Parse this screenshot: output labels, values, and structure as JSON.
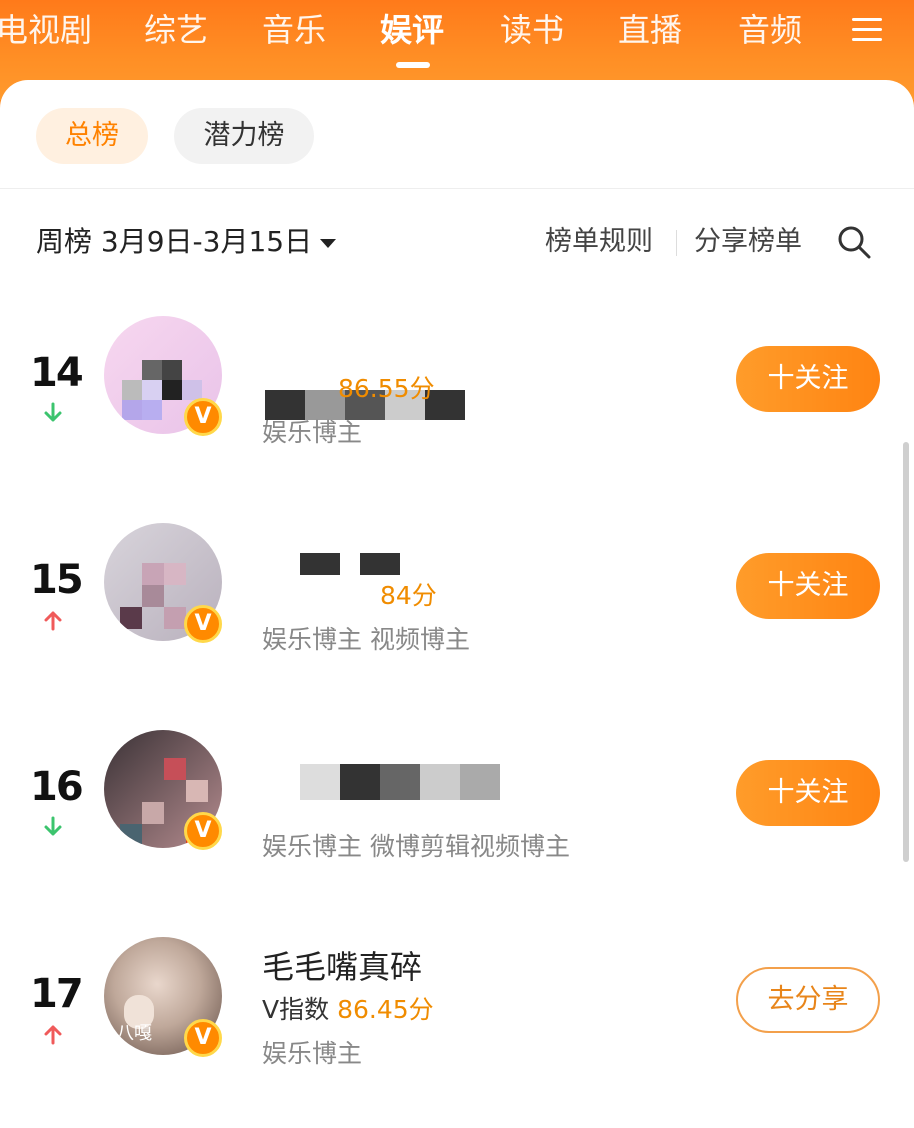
{
  "nav": {
    "tabs": [
      "电视剧",
      "综艺",
      "音乐",
      "娱评",
      "读书",
      "直播",
      "音频"
    ],
    "active_tab": "娱评",
    "menu_icon": "menu-icon"
  },
  "chips": {
    "primary": "总榜",
    "secondary": "潜力榜"
  },
  "filter": {
    "period": "周榜 3月9日-3月15日",
    "rules": "榜单规则",
    "share": "分享榜单"
  },
  "rows": [
    {
      "rank": "14",
      "trend": "down",
      "name": "",
      "vindex_label": "",
      "score": "86.55分",
      "tags": "娱乐博主",
      "button": "十关注"
    },
    {
      "rank": "15",
      "trend": "up",
      "name": "",
      "vindex_label": "",
      "score": "84分",
      "tags": "娱乐博主 视频博主",
      "button": "十关注"
    },
    {
      "rank": "16",
      "trend": "down",
      "name": "",
      "vindex_label": "",
      "score": "",
      "tags": "娱乐博主 微博剪辑视频博主",
      "button": "十关注"
    },
    {
      "rank": "17",
      "trend": "up",
      "name": "毛毛嘴真碎",
      "vindex_label": "V指数",
      "score": "86.45分",
      "tags": "娱乐博主",
      "button": "去分享",
      "avatar_caption": "八嘎"
    }
  ],
  "colors": {
    "brand_orange": "#ff8a1e",
    "score_orange": "#f08c00",
    "trend_up": "#f05a5a",
    "trend_down": "#3cc46e"
  }
}
